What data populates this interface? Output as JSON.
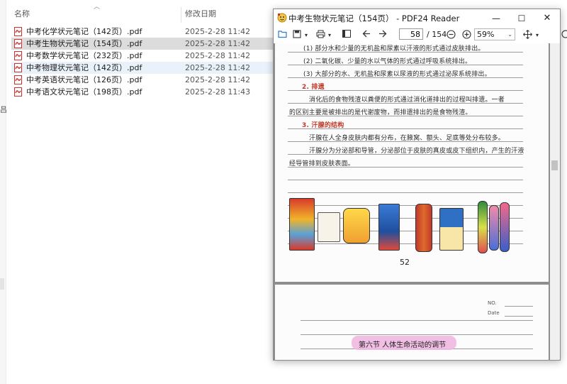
{
  "explorer": {
    "columns": {
      "name": "名称",
      "date": "修改日期"
    },
    "left_glyph": "吕",
    "files": [
      {
        "name": "中考化学状元笔记（142页）.pdf",
        "date": "2025-2-28 11:42"
      },
      {
        "name": "中考生物状元笔记（154页）.pdf",
        "date": "2025-2-28 11:42"
      },
      {
        "name": "中考数学状元笔记（232页）.pdf",
        "date": "2025-2-28 11:42"
      },
      {
        "name": "中考物理状元笔记（142页）.pdf",
        "date": "2025-2-28 11:42"
      },
      {
        "name": "中考英语状元笔记（126页）.pdf",
        "date": "2025-2-28 11:42"
      },
      {
        "name": "中考语文状元笔记（198页）.pdf",
        "date": "2025-2-28 11:43"
      }
    ]
  },
  "reader": {
    "title": "中考生物状元笔记（154页） - PDF24 Reader",
    "current_page": "58",
    "page_total": "/ 154",
    "zoom": "59%",
    "window_buttons": {
      "minimize": "—",
      "maximize": "☐",
      "close": "✕"
    },
    "page1": {
      "lines": [
        "(1) 部分水和少量的无机盐和尿素以汗液的形式通过皮肤排出。",
        "(2) 二氧化碳、少量的水以气体的形式通过呼吸系统排出。",
        "(3) 大部分的水、无机盐和尿素以尿液的形式通过泌尿系统排出。",
        "2. 排遗",
        "消化后的食物残渣以粪便的形式通过消化道排出的过程叫排遗。一者",
        "的区别主要是被排出的是代谢废物，而排遗排出的是食物残渣。",
        "3. 汗腺的结构",
        "汗腺在人全身皮肤内都有分布，在腋窝、额头、足底等处分布较多。",
        "汗腺分为分泌部和导管，分泌部位于皮肤的真皮或皮下组织内，产生的汗液",
        "经导管排到皮肤表面。"
      ],
      "page_number": "52"
    },
    "page2": {
      "no_label": "NO.",
      "date_label": "Date",
      "heading": "第六节  人体生命活动的调节"
    }
  },
  "colors": {
    "selected_row": "#dcdcdc",
    "hover_row": "#e9f2fb",
    "pdf_red": "#d0312d",
    "viewer_gray": "#8e8e8e",
    "handwriting_red": "#c0392b",
    "highlight_pink": "#efb8e0"
  },
  "icons": [
    "pdf-file-icon",
    "pdf24-app-icon",
    "open-folder-icon",
    "save-icon",
    "print-icon",
    "sidebar-icon",
    "back-arrow-icon",
    "forward-arrow-icon",
    "zoom-out-icon",
    "zoom-in-icon",
    "move-icon",
    "rotate-icon"
  ]
}
